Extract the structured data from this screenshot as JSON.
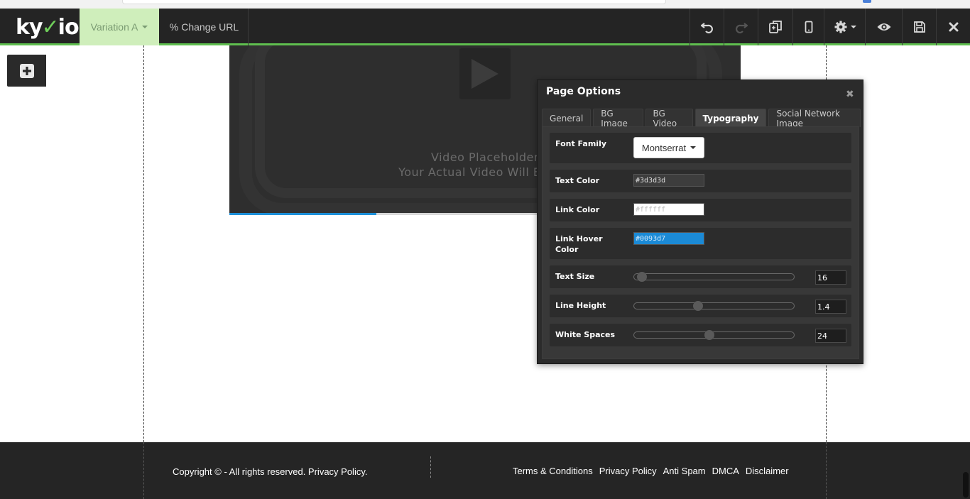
{
  "toolbar": {
    "logo_text": "kyvio",
    "variation_label": "Variation A",
    "change_url_label": "Change URL",
    "icons": [
      "undo-icon",
      "redo-icon",
      "copy-icon",
      "mobile-icon",
      "gear-icon",
      "eye-icon",
      "save-icon",
      "close-icon"
    ],
    "accent_color": "#5fbf4f"
  },
  "video": {
    "line1": "Video Placeholder",
    "line2": "Your Actual Video Will Be Dis",
    "progress": 0.287
  },
  "panel": {
    "title": "Page Options",
    "tabs": [
      {
        "label": "General"
      },
      {
        "label": "BG Image"
      },
      {
        "label": "BG Video"
      },
      {
        "label": "Typography"
      },
      {
        "label": "Social Network Image"
      }
    ],
    "active_tab": "Typography",
    "font_family": {
      "label": "Font Family",
      "value": "Montserrat"
    },
    "text_color": {
      "label": "Text Color",
      "value": "#3d3d3d"
    },
    "link_color": {
      "label": "Link Color",
      "value": "#ffffff"
    },
    "link_hover_color": {
      "label": "Link Hover Color",
      "value": "#0093d7"
    },
    "text_size": {
      "label": "Text Size",
      "value": "16",
      "slider_fraction": 0.05
    },
    "line_height": {
      "label": "Line Height",
      "value": "1.4",
      "slider_fraction": 0.4
    },
    "white_spaces": {
      "label": "White Spaces",
      "value": "24",
      "slider_fraction": 0.47
    }
  },
  "footer": {
    "copyright": "Copyright © - All rights reserved. Privacy Policy.",
    "links": [
      "Terms & Conditions",
      "Privacy Policy",
      "Anti Spam",
      "DMCA",
      "Disclaimer"
    ]
  }
}
